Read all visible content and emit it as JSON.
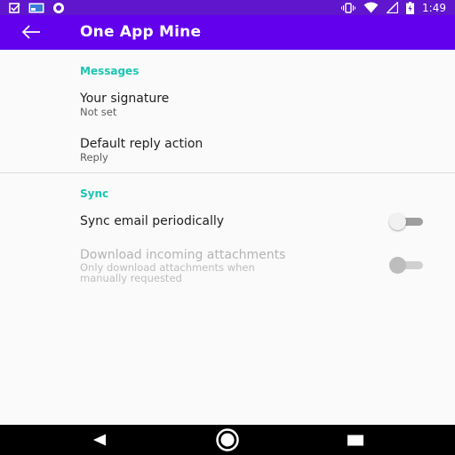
{
  "status_bar": {
    "time": "1:49",
    "left_icons": [
      "task-icon",
      "media-icon",
      "record-icon"
    ],
    "right_icons": [
      "vibrate-icon",
      "wifi-icon",
      "signal-icon",
      "battery-charging-icon"
    ]
  },
  "app_bar": {
    "title": "One App Mine",
    "back_icon": "arrow-back-icon"
  },
  "sections": {
    "messages": {
      "header": "Messages",
      "signature": {
        "title": "Your signature",
        "summary": "Not set"
      },
      "reply_action": {
        "title": "Default reply action",
        "summary": "Reply"
      }
    },
    "sync": {
      "header": "Sync",
      "sync_periodically": {
        "title": "Sync email periodically",
        "enabled": true,
        "checked": false
      },
      "download_attachments": {
        "title": "Download incoming attachments",
        "summary_line1": "Only download attachments when",
        "summary_line2": "manually requested",
        "enabled": false,
        "checked": false
      }
    }
  },
  "colors": {
    "status_bar": "#5f16cc",
    "app_bar": "#6200ee",
    "accent": "#1bc5b1",
    "background": "#fafafa",
    "nav_bar": "#000000"
  },
  "nav_bar": {
    "icons": [
      "back-triangle-icon",
      "home-circle-icon",
      "recents-square-icon"
    ]
  }
}
